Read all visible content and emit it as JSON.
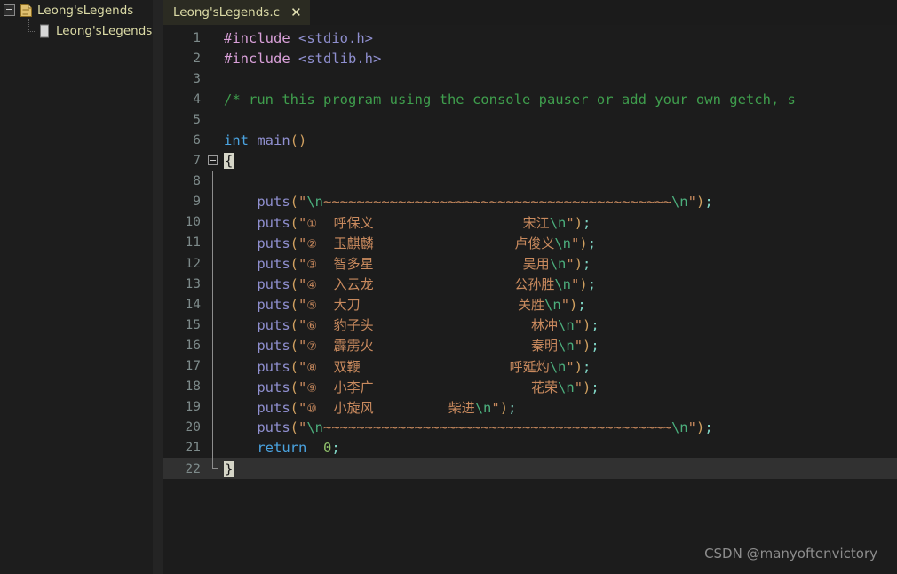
{
  "sidebar": {
    "project": {
      "name": "Leong'sLegends",
      "icon": "project-shield-icon",
      "expanded": true,
      "toggle_icon": "collapse-box-icon"
    },
    "file": {
      "name": "Leong'sLegends.c",
      "icon": "c-file-icon"
    }
  },
  "tabs": [
    {
      "label": "Leong'sLegends.c",
      "active": true,
      "close_icon": "close-icon"
    }
  ],
  "editor": {
    "active_line": 22,
    "lines": [
      {
        "n": "1",
        "fold": "none",
        "tokens": [
          {
            "t": "#include",
            "c": "t-pre"
          },
          {
            "t": " ",
            "c": "t-plain"
          },
          {
            "t": "<stdio.h>",
            "c": "t-inc"
          }
        ]
      },
      {
        "n": "2",
        "fold": "none",
        "tokens": [
          {
            "t": "#include",
            "c": "t-pre"
          },
          {
            "t": " ",
            "c": "t-plain"
          },
          {
            "t": "<stdlib.h>",
            "c": "t-inc"
          }
        ]
      },
      {
        "n": "3",
        "fold": "none",
        "tokens": []
      },
      {
        "n": "4",
        "fold": "none",
        "tokens": [
          {
            "t": "/* run this program using the console pauser or add your own getch, s",
            "c": "t-cmt"
          }
        ]
      },
      {
        "n": "5",
        "fold": "none",
        "tokens": []
      },
      {
        "n": "6",
        "fold": "none",
        "tokens": [
          {
            "t": "int",
            "c": "t-kw"
          },
          {
            "t": " ",
            "c": "t-plain"
          },
          {
            "t": "main",
            "c": "t-fn"
          },
          {
            "t": "()",
            "c": "t-punct"
          }
        ]
      },
      {
        "n": "7",
        "fold": "box",
        "tokens": [
          {
            "t": "{",
            "c": "t-punct brace-hl"
          }
        ]
      },
      {
        "n": "8",
        "fold": "line",
        "tokens": []
      },
      {
        "n": "9",
        "fold": "line",
        "tokens": [
          {
            "t": "    ",
            "c": "t-plain"
          },
          {
            "t": "puts",
            "c": "t-fn"
          },
          {
            "t": "(",
            "c": "t-punct"
          },
          {
            "t": "\"",
            "c": "t-str"
          },
          {
            "t": "\\n",
            "c": "t-esc"
          },
          {
            "t": "~~~~~~~~~~~~~~~~~~~~~~~~~~~~~~~~~~~~~~~~~~",
            "c": "t-tilde"
          },
          {
            "t": "\\n",
            "c": "t-esc"
          },
          {
            "t": "\"",
            "c": "t-str"
          },
          {
            "t": ")",
            "c": "t-punct"
          },
          {
            "t": ";",
            "c": "t-semi"
          }
        ]
      },
      {
        "n": "10",
        "fold": "line",
        "tokens": [
          {
            "t": "    ",
            "c": "t-plain"
          },
          {
            "t": "puts",
            "c": "t-fn"
          },
          {
            "t": "(",
            "c": "t-punct"
          },
          {
            "t": "\"",
            "c": "t-str"
          },
          {
            "t": "①",
            "c": "t-circ"
          },
          {
            "t": "  ",
            "c": "t-str"
          },
          {
            "t": "呼保义",
            "c": "t-cjk"
          },
          {
            "t": "                  ",
            "c": "t-str"
          },
          {
            "t": "宋江",
            "c": "t-cjk"
          },
          {
            "t": "\\n",
            "c": "t-esc"
          },
          {
            "t": "\"",
            "c": "t-str"
          },
          {
            "t": ")",
            "c": "t-punct"
          },
          {
            "t": ";",
            "c": "t-semi"
          }
        ]
      },
      {
        "n": "11",
        "fold": "line",
        "tokens": [
          {
            "t": "    ",
            "c": "t-plain"
          },
          {
            "t": "puts",
            "c": "t-fn"
          },
          {
            "t": "(",
            "c": "t-punct"
          },
          {
            "t": "\"",
            "c": "t-str"
          },
          {
            "t": "②",
            "c": "t-circ"
          },
          {
            "t": "  ",
            "c": "t-str"
          },
          {
            "t": "玉麒麟",
            "c": "t-cjk"
          },
          {
            "t": "                 ",
            "c": "t-str"
          },
          {
            "t": "卢俊义",
            "c": "t-cjk"
          },
          {
            "t": "\\n",
            "c": "t-esc"
          },
          {
            "t": "\"",
            "c": "t-str"
          },
          {
            "t": ")",
            "c": "t-punct"
          },
          {
            "t": ";",
            "c": "t-semi"
          }
        ]
      },
      {
        "n": "12",
        "fold": "line",
        "tokens": [
          {
            "t": "    ",
            "c": "t-plain"
          },
          {
            "t": "puts",
            "c": "t-fn"
          },
          {
            "t": "(",
            "c": "t-punct"
          },
          {
            "t": "\"",
            "c": "t-str"
          },
          {
            "t": "③",
            "c": "t-circ"
          },
          {
            "t": "  ",
            "c": "t-str"
          },
          {
            "t": "智多星",
            "c": "t-cjk"
          },
          {
            "t": "                  ",
            "c": "t-str"
          },
          {
            "t": "吴用",
            "c": "t-cjk"
          },
          {
            "t": "\\n",
            "c": "t-esc"
          },
          {
            "t": "\"",
            "c": "t-str"
          },
          {
            "t": ")",
            "c": "t-punct"
          },
          {
            "t": ";",
            "c": "t-semi"
          }
        ]
      },
      {
        "n": "13",
        "fold": "line",
        "tokens": [
          {
            "t": "    ",
            "c": "t-plain"
          },
          {
            "t": "puts",
            "c": "t-fn"
          },
          {
            "t": "(",
            "c": "t-punct"
          },
          {
            "t": "\"",
            "c": "t-str"
          },
          {
            "t": "④",
            "c": "t-circ"
          },
          {
            "t": "  ",
            "c": "t-str"
          },
          {
            "t": "入云龙",
            "c": "t-cjk"
          },
          {
            "t": "                 ",
            "c": "t-str"
          },
          {
            "t": "公孙胜",
            "c": "t-cjk"
          },
          {
            "t": "\\n",
            "c": "t-esc"
          },
          {
            "t": "\"",
            "c": "t-str"
          },
          {
            "t": ")",
            "c": "t-punct"
          },
          {
            "t": ";",
            "c": "t-semi"
          }
        ]
      },
      {
        "n": "14",
        "fold": "line",
        "tokens": [
          {
            "t": "    ",
            "c": "t-plain"
          },
          {
            "t": "puts",
            "c": "t-fn"
          },
          {
            "t": "(",
            "c": "t-punct"
          },
          {
            "t": "\"",
            "c": "t-str"
          },
          {
            "t": "⑤",
            "c": "t-circ"
          },
          {
            "t": "  ",
            "c": "t-str"
          },
          {
            "t": "大刀",
            "c": "t-cjk"
          },
          {
            "t": "                   ",
            "c": "t-str"
          },
          {
            "t": "关胜",
            "c": "t-cjk"
          },
          {
            "t": "\\n",
            "c": "t-esc"
          },
          {
            "t": "\"",
            "c": "t-str"
          },
          {
            "t": ")",
            "c": "t-punct"
          },
          {
            "t": ";",
            "c": "t-semi"
          }
        ]
      },
      {
        "n": "15",
        "fold": "line",
        "tokens": [
          {
            "t": "    ",
            "c": "t-plain"
          },
          {
            "t": "puts",
            "c": "t-fn"
          },
          {
            "t": "(",
            "c": "t-punct"
          },
          {
            "t": "\"",
            "c": "t-str"
          },
          {
            "t": "⑥",
            "c": "t-circ"
          },
          {
            "t": "  ",
            "c": "t-str"
          },
          {
            "t": "豹子头",
            "c": "t-cjk"
          },
          {
            "t": "                   ",
            "c": "t-str"
          },
          {
            "t": "林冲",
            "c": "t-cjk"
          },
          {
            "t": "\\n",
            "c": "t-esc"
          },
          {
            "t": "\"",
            "c": "t-str"
          },
          {
            "t": ")",
            "c": "t-punct"
          },
          {
            "t": ";",
            "c": "t-semi"
          }
        ]
      },
      {
        "n": "16",
        "fold": "line",
        "tokens": [
          {
            "t": "    ",
            "c": "t-plain"
          },
          {
            "t": "puts",
            "c": "t-fn"
          },
          {
            "t": "(",
            "c": "t-punct"
          },
          {
            "t": "\"",
            "c": "t-str"
          },
          {
            "t": "⑦",
            "c": "t-circ"
          },
          {
            "t": "  ",
            "c": "t-str"
          },
          {
            "t": "霹雳火",
            "c": "t-cjk"
          },
          {
            "t": "                   ",
            "c": "t-str"
          },
          {
            "t": "秦明",
            "c": "t-cjk"
          },
          {
            "t": "\\n",
            "c": "t-esc"
          },
          {
            "t": "\"",
            "c": "t-str"
          },
          {
            "t": ")",
            "c": "t-punct"
          },
          {
            "t": ";",
            "c": "t-semi"
          }
        ]
      },
      {
        "n": "17",
        "fold": "line",
        "tokens": [
          {
            "t": "    ",
            "c": "t-plain"
          },
          {
            "t": "puts",
            "c": "t-fn"
          },
          {
            "t": "(",
            "c": "t-punct"
          },
          {
            "t": "\"",
            "c": "t-str"
          },
          {
            "t": "⑧",
            "c": "t-circ"
          },
          {
            "t": "  ",
            "c": "t-str"
          },
          {
            "t": "双鞭",
            "c": "t-cjk"
          },
          {
            "t": "                  ",
            "c": "t-str"
          },
          {
            "t": "呼延灼",
            "c": "t-cjk"
          },
          {
            "t": "\\n",
            "c": "t-esc"
          },
          {
            "t": "\"",
            "c": "t-str"
          },
          {
            "t": ")",
            "c": "t-punct"
          },
          {
            "t": ";",
            "c": "t-semi"
          }
        ]
      },
      {
        "n": "18",
        "fold": "line",
        "tokens": [
          {
            "t": "    ",
            "c": "t-plain"
          },
          {
            "t": "puts",
            "c": "t-fn"
          },
          {
            "t": "(",
            "c": "t-punct"
          },
          {
            "t": "\"",
            "c": "t-str"
          },
          {
            "t": "⑨",
            "c": "t-circ"
          },
          {
            "t": "  ",
            "c": "t-str"
          },
          {
            "t": "小李广",
            "c": "t-cjk"
          },
          {
            "t": "                   ",
            "c": "t-str"
          },
          {
            "t": "花荣",
            "c": "t-cjk"
          },
          {
            "t": "\\n",
            "c": "t-esc"
          },
          {
            "t": "\"",
            "c": "t-str"
          },
          {
            "t": ")",
            "c": "t-punct"
          },
          {
            "t": ";",
            "c": "t-semi"
          }
        ]
      },
      {
        "n": "19",
        "fold": "line",
        "tokens": [
          {
            "t": "    ",
            "c": "t-plain"
          },
          {
            "t": "puts",
            "c": "t-fn"
          },
          {
            "t": "(",
            "c": "t-punct"
          },
          {
            "t": "\"",
            "c": "t-str"
          },
          {
            "t": "⑩",
            "c": "t-circ"
          },
          {
            "t": "  ",
            "c": "t-str"
          },
          {
            "t": "小旋风",
            "c": "t-cjk"
          },
          {
            "t": "         ",
            "c": "t-str"
          },
          {
            "t": "柴进",
            "c": "t-cjk"
          },
          {
            "t": "\\n",
            "c": "t-esc"
          },
          {
            "t": "\"",
            "c": "t-str"
          },
          {
            "t": ")",
            "c": "t-punct"
          },
          {
            "t": ";",
            "c": "t-semi"
          }
        ]
      },
      {
        "n": "20",
        "fold": "line",
        "tokens": [
          {
            "t": "    ",
            "c": "t-plain"
          },
          {
            "t": "puts",
            "c": "t-fn"
          },
          {
            "t": "(",
            "c": "t-punct"
          },
          {
            "t": "\"",
            "c": "t-str"
          },
          {
            "t": "\\n",
            "c": "t-esc"
          },
          {
            "t": "~~~~~~~~~~~~~~~~~~~~~~~~~~~~~~~~~~~~~~~~~~",
            "c": "t-tilde"
          },
          {
            "t": "\\n",
            "c": "t-esc"
          },
          {
            "t": "\"",
            "c": "t-str"
          },
          {
            "t": ")",
            "c": "t-punct"
          },
          {
            "t": ";",
            "c": "t-semi"
          }
        ]
      },
      {
        "n": "21",
        "fold": "line",
        "tokens": [
          {
            "t": "    ",
            "c": "t-plain"
          },
          {
            "t": "return",
            "c": "t-kw"
          },
          {
            "t": "  ",
            "c": "t-plain"
          },
          {
            "t": "0",
            "c": "t-num"
          },
          {
            "t": ";",
            "c": "t-semi"
          }
        ]
      },
      {
        "n": "22",
        "fold": "endline",
        "active": true,
        "tokens": [
          {
            "t": "}",
            "c": "t-punct brace-hl"
          }
        ]
      }
    ]
  },
  "watermark": {
    "text": "CSDN @manyoftenvictory"
  },
  "colors": {
    "editor_bg": "#1c1c1c",
    "sidebar_bg": "#1d1d1d",
    "tab_active_bg": "#2b2b22",
    "tab_text": "#dcdba6",
    "gutter_text": "#7d8a8a",
    "active_line_bg": "#313131",
    "preproc": "#d9a0d9",
    "comment": "#3f9e4d",
    "keyword": "#4aa3e0",
    "string": "#c98a5e",
    "escape": "#4caf7d",
    "number": "#8fbf6a",
    "semicolon": "#7fd4c4",
    "watermark_text": "#8d8d8d"
  }
}
